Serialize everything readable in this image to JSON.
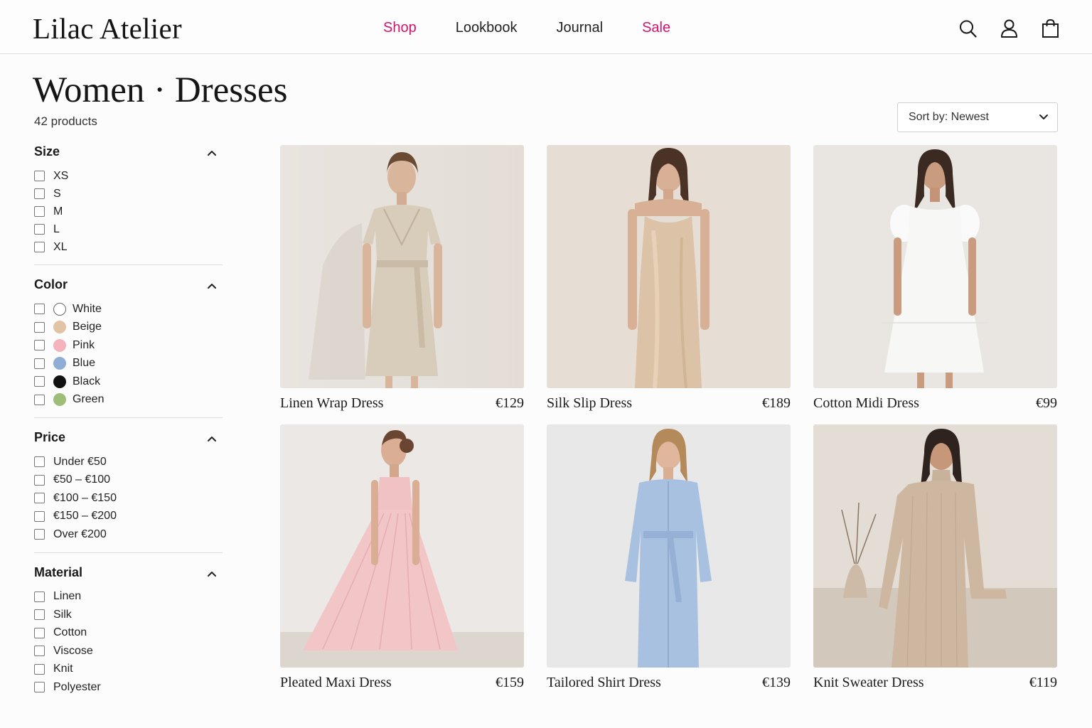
{
  "brand": {
    "name": "Lilac Atelier"
  },
  "nav": [
    {
      "label": "Shop",
      "accent": true
    },
    {
      "label": "Lookbook",
      "accent": false
    },
    {
      "label": "Journal",
      "accent": false
    },
    {
      "label": "Sale",
      "accent": true
    }
  ],
  "header_icons": [
    "search-icon",
    "account-icon",
    "shopping-bag-icon"
  ],
  "page": {
    "title": "Women · Dresses",
    "count": "42 products"
  },
  "sort": {
    "label": "Sort by: Newest"
  },
  "filters": {
    "size": {
      "title": "Size",
      "options": [
        "XS",
        "S",
        "M",
        "L",
        "XL"
      ]
    },
    "color": {
      "title": "Color",
      "options": [
        {
          "label": "White",
          "swatch": "#ffffff"
        },
        {
          "label": "Beige",
          "swatch": "#e2c3a3"
        },
        {
          "label": "Pink",
          "swatch": "#f4b3bd"
        },
        {
          "label": "Blue",
          "swatch": "#8eaed6"
        },
        {
          "label": "Black",
          "swatch": "#111111"
        },
        {
          "label": "Green",
          "swatch": "#9ebd78"
        }
      ]
    },
    "price": {
      "title": "Price",
      "options": [
        "Under €50",
        "€50 – €100",
        "€100 – €150",
        "€150 – €200",
        "Over €200"
      ]
    },
    "material": {
      "title": "Material",
      "options": [
        "Linen",
        "Silk",
        "Cotton",
        "Viscose",
        "Knit",
        "Polyester"
      ]
    }
  },
  "products": [
    {
      "name": "Linen Wrap Dress",
      "price": "€129"
    },
    {
      "name": "Silk Slip Dress",
      "price": "€189"
    },
    {
      "name": "Cotton Midi Dress",
      "price": "€99"
    },
    {
      "name": "Pleated Maxi Dress",
      "price": "€159"
    },
    {
      "name": "Tailored Shirt Dress",
      "price": "€139"
    },
    {
      "name": "Knit Sweater Dress",
      "price": "€119"
    }
  ],
  "colors": {
    "accent": "#d4146f",
    "border": "#dcdcdc",
    "text": "#1a1a1a"
  }
}
